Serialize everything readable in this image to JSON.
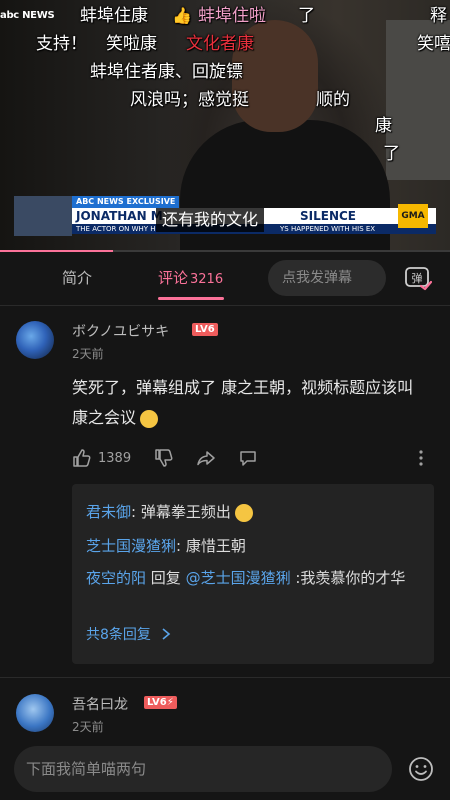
{
  "video": {
    "channel_logo": "abc NEWS",
    "danmaku": [
      {
        "text": "蚌埠住康",
        "color": "white"
      },
      {
        "text": "蚌埠住啦",
        "color": "pink"
      },
      {
        "text": "了",
        "color": "white"
      },
      {
        "text": "释",
        "color": "white"
      },
      {
        "text": "支持！",
        "color": "white"
      },
      {
        "text": "笑啦康",
        "color": "white"
      },
      {
        "text": "文化者康",
        "color": "red"
      },
      {
        "text": "笑嘻",
        "color": "white"
      },
      {
        "text": "蚌埠住者康、回旋镖",
        "color": "white"
      },
      {
        "text": "风浪吗；感觉挺",
        "color": "white"
      },
      {
        "text": "顺的",
        "color": "white"
      },
      {
        "text": "康",
        "color": "white"
      },
      {
        "text": "了",
        "color": "white"
      }
    ],
    "news_tag": "ABC NEWS EXCLUSIVE",
    "news_headline": "JONATHAN M",
    "news_headline_end": "SILENCE",
    "news_sub": "THE ACTOR ON WHY H",
    "news_sub_end": "YS HAPPENED WITH HIS EX",
    "news_badge": "GMA",
    "subtitle": "还有我的文化",
    "progress": 0.25,
    "accent": "#fb7299"
  },
  "tabs": {
    "intro": "简介",
    "comments": "评论",
    "comments_count": "3216",
    "danmaku_placeholder": "点我发弹幕",
    "danmaku_toggle_glyph": "弹"
  },
  "comments": [
    {
      "username": "ボクノユビサキ",
      "level": "LV6",
      "time": "2天前",
      "content": "笑死了，弹幕组成了 康之王朝，视频标题应该叫 康之会议",
      "likes": "1389",
      "replies": [
        {
          "user": "君未御",
          "text": ": 弹幕拳王频出"
        },
        {
          "user": "芝士国漫猹猁",
          "text": ": 康惜王朝"
        },
        {
          "user": "夜空的阳",
          "mid": " 回复 ",
          "target": "@芝士国漫猹猁",
          "text": " :我羡慕你的才华"
        }
      ],
      "more_replies": "共8条回复"
    },
    {
      "username": "吾名曰龙",
      "level": "LV6⚡",
      "time": "2天前"
    }
  ],
  "bottom": {
    "placeholder": "下面我简单喵两句"
  }
}
